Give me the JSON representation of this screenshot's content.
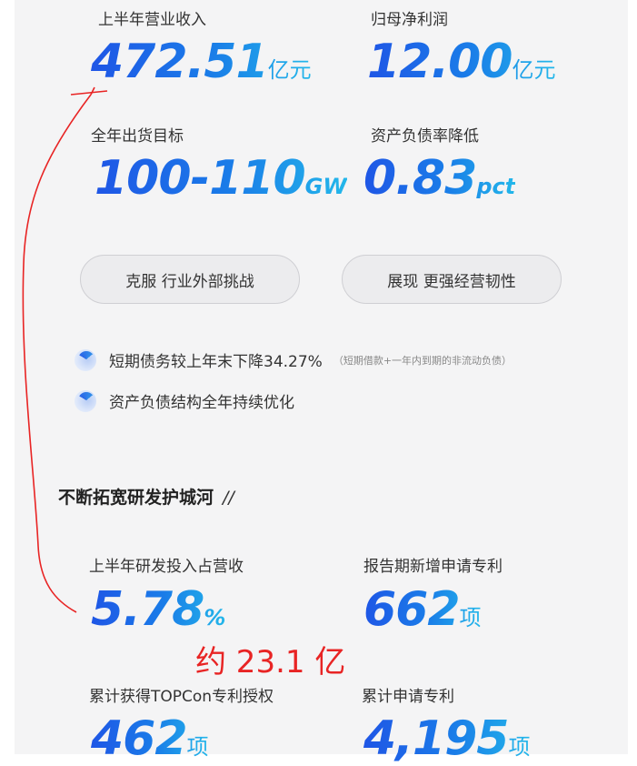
{
  "metrics_top": [
    {
      "label": "上半年营业收入",
      "value": "472.51",
      "unit": "亿元"
    },
    {
      "label": "归母净利润",
      "value": "12.00",
      "unit": "亿元"
    },
    {
      "label": "全年出货目标",
      "value": "100-110",
      "unit": "GW"
    },
    {
      "label": "资产负债率降低",
      "value": "0.83",
      "unit": "pct"
    }
  ],
  "pills": [
    "克服 行业外部挑战",
    "展现 更强经营韧性"
  ],
  "bullets": [
    {
      "text": "短期债务较上年末下降34.27%",
      "note": "（短期借款+一年内到期的非流动负债）"
    },
    {
      "text": "资产负债结构全年持续优化",
      "note": ""
    }
  ],
  "section": {
    "title": "不断拓宽研发护城河",
    "suffix": "//"
  },
  "metrics_bottom": [
    {
      "label": "上半年研发投入占营收",
      "value": "5.78",
      "unit": "%"
    },
    {
      "label": "报告期新增申请专利",
      "value": "662",
      "unit": "项"
    },
    {
      "label": "累计获得TOPCon专利授权",
      "value": "462",
      "unit": "项"
    },
    {
      "label": "累计申请专利",
      "value": "4,195",
      "unit": "项"
    }
  ],
  "annotation": "约 23.1 亿",
  "colors": {
    "accent_start": "#1f56e6",
    "accent_end": "#23b7ea",
    "annotation": "#e82424"
  }
}
